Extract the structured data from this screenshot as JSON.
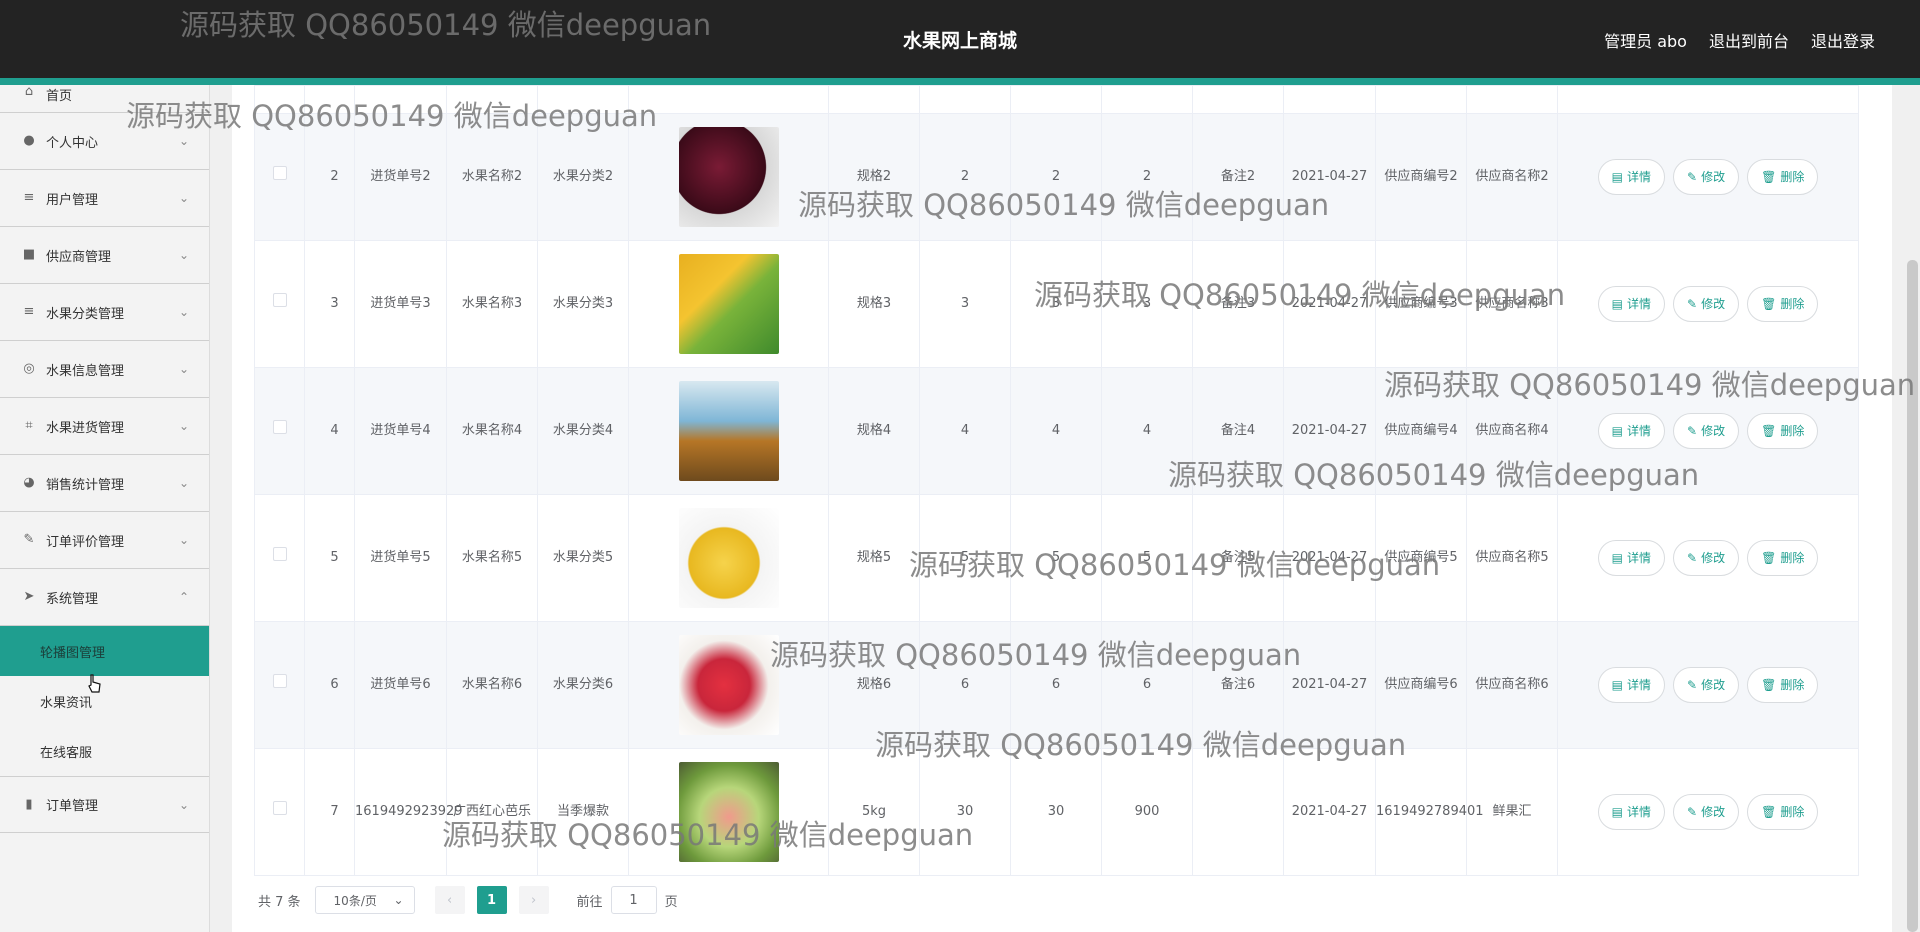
{
  "header": {
    "title": "水果网上商城",
    "admin_label": "管理员 abo",
    "front_link": "退出到前台",
    "logout_link": "退出登录"
  },
  "sidebar": {
    "home": "首页",
    "items": [
      {
        "label": "个人中心",
        "icon": "person-icon"
      },
      {
        "label": "用户管理",
        "icon": "list-icon"
      },
      {
        "label": "供应商管理",
        "icon": "box-icon"
      },
      {
        "label": "水果分类管理",
        "icon": "list-icon"
      },
      {
        "label": "水果信息管理",
        "icon": "compass-icon"
      },
      {
        "label": "水果进货管理",
        "icon": "crop-icon"
      },
      {
        "label": "销售统计管理",
        "icon": "chart-icon"
      },
      {
        "label": "订单评价管理",
        "icon": "edit-icon"
      },
      {
        "label": "系统管理",
        "icon": "send-icon"
      }
    ],
    "sub_items": [
      "轮播图管理",
      "水果资讯",
      "在线客服"
    ],
    "last_item": {
      "label": "订单管理",
      "icon": "bar-chart-icon"
    }
  },
  "table": {
    "rows": [
      {
        "index": "2",
        "code": "进货单号2",
        "name": "水果名称2",
        "category": "水果分类2",
        "spec": "规格2",
        "qty": "2",
        "price": "2",
        "total": "2",
        "remark": "备注2",
        "date": "2021-04-27",
        "supplier_code": "供应商编号2",
        "supplier_name": "供应商名称2"
      },
      {
        "index": "3",
        "code": "进货单号3",
        "name": "水果名称3",
        "category": "水果分类3",
        "spec": "规格3",
        "qty": "3",
        "price": "3",
        "total": "3",
        "remark": "备注3",
        "date": "2021-04-27",
        "supplier_code": "供应商编号3",
        "supplier_name": "供应商名称3"
      },
      {
        "index": "4",
        "code": "进货单号4",
        "name": "水果名称4",
        "category": "水果分类4",
        "spec": "规格4",
        "qty": "4",
        "price": "4",
        "total": "4",
        "remark": "备注4",
        "date": "2021-04-27",
        "supplier_code": "供应商编号4",
        "supplier_name": "供应商名称4"
      },
      {
        "index": "5",
        "code": "进货单号5",
        "name": "水果名称5",
        "category": "水果分类5",
        "spec": "规格5",
        "qty": "5",
        "price": "5",
        "total": "5",
        "remark": "备注5",
        "date": "2021-04-27",
        "supplier_code": "供应商编号5",
        "supplier_name": "供应商名称5"
      },
      {
        "index": "6",
        "code": "进货单号6",
        "name": "水果名称6",
        "category": "水果分类6",
        "spec": "规格6",
        "qty": "6",
        "price": "6",
        "total": "6",
        "remark": "备注6",
        "date": "2021-04-27",
        "supplier_code": "供应商编号6",
        "supplier_name": "供应商名称6"
      },
      {
        "index": "7",
        "code": "1619492923929",
        "name": "广西红心芭乐",
        "category": "当季爆款",
        "spec": "5kg",
        "qty": "30",
        "price": "30",
        "total": "900",
        "remark": "",
        "date": "2021-04-27",
        "supplier_code": "1619492789401",
        "supplier_name": "鲜果汇"
      }
    ],
    "actions": {
      "detail": "详情",
      "edit": "修改",
      "delete": "删除"
    }
  },
  "pagination": {
    "total": "共 7 条",
    "page_size": "10条/页",
    "current_page": "1",
    "goto_label": "前往",
    "goto_value": "1",
    "page_suffix": "页"
  },
  "watermark": "源码获取 QQ86050149 微信deepguan",
  "colors": {
    "accent": "#1f9e8f",
    "topbar": "#232323"
  }
}
